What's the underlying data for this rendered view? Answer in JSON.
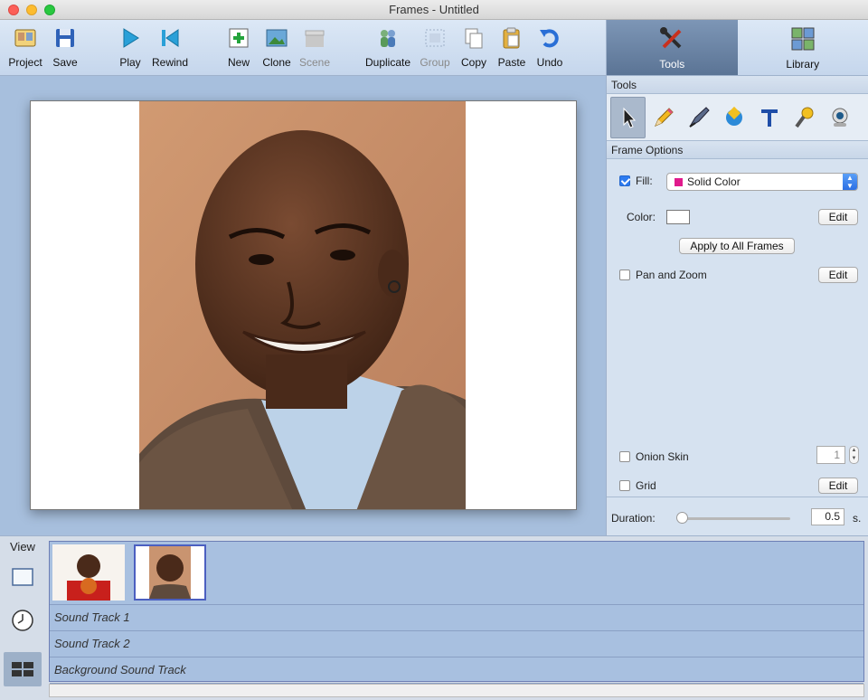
{
  "window": {
    "title": "Frames - Untitled"
  },
  "toolbar": {
    "project": "Project",
    "save": "Save",
    "play": "Play",
    "rewind": "Rewind",
    "new": "New",
    "clone": "Clone",
    "scene": "Scene",
    "duplicate": "Duplicate",
    "group": "Group",
    "copy": "Copy",
    "paste": "Paste",
    "undo": "Undo"
  },
  "panel": {
    "tabs": {
      "tools": "Tools",
      "library": "Library"
    },
    "tools_header": "Tools",
    "frame_options_header": "Frame Options",
    "fill_label": "Fill:",
    "fill_value": "Solid Color",
    "fill_swatch": "#e01a8c",
    "color_label": "Color:",
    "edit": "Edit",
    "apply_all": "Apply to All Frames",
    "pan_zoom": "Pan and Zoom",
    "onion_skin": "Onion Skin",
    "onion_value": "1",
    "grid": "Grid",
    "duration_label": "Duration:",
    "duration_value": "0.5",
    "duration_unit": "s."
  },
  "timeline": {
    "view_label": "View",
    "tracks": [
      "Sound Track 1",
      "Sound Track 2",
      "Background Sound Track"
    ]
  },
  "colors": {
    "accent": "#2d7bf0",
    "stage": "#a7bfdd",
    "timeline": "#a8c0e0"
  }
}
